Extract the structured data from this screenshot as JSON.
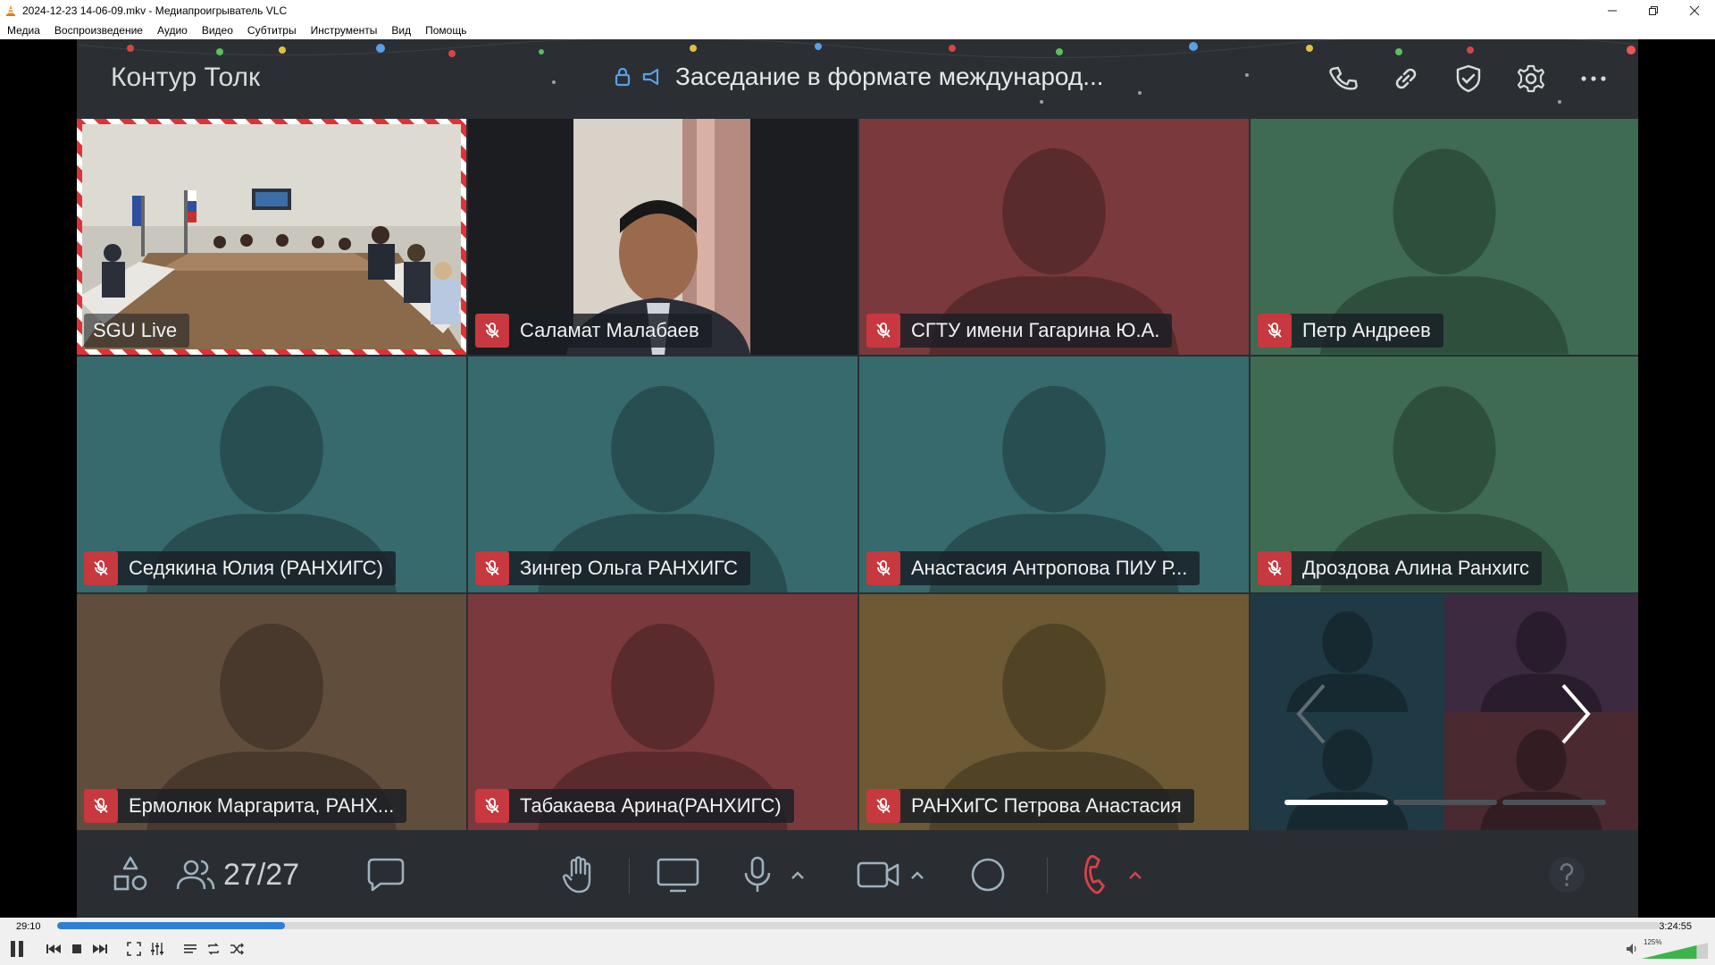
{
  "window": {
    "title": "2024-12-23 14-06-09.mkv - Медиапроигрыватель VLC"
  },
  "menu": [
    "Медиа",
    "Воспроизведение",
    "Аудио",
    "Видео",
    "Субтитры",
    "Инструменты",
    "Вид",
    "Помощь"
  ],
  "meeting": {
    "brand": "Контур Толк",
    "title": "Заседание в формате международ...",
    "header_icons": [
      "phone-icon",
      "link-icon",
      "shield-check-icon",
      "gear-icon",
      "more-icon"
    ]
  },
  "tiles": [
    {
      "name": "SGU Live",
      "type": "video-room",
      "muted": false,
      "highlight": true
    },
    {
      "name": "Саламат Малабаев",
      "type": "video-person",
      "muted": true,
      "color": "#1b1d20"
    },
    {
      "name": "СГТУ имени Гагарина Ю.А.",
      "type": "avatar",
      "muted": true,
      "color": "#7a3a3d"
    },
    {
      "name": "Петр Андреев",
      "type": "avatar",
      "muted": true,
      "color": "#3f6b52"
    },
    {
      "name": "Седякина Юлия (РАНХИГС)",
      "type": "avatar",
      "muted": true,
      "color": "#366a6d"
    },
    {
      "name": "Зингер Ольга РАНХИГС",
      "type": "avatar",
      "muted": true,
      "color": "#366a6d"
    },
    {
      "name": "Анастасия Антропова ПИУ Р...",
      "type": "avatar",
      "muted": true,
      "color": "#366a6d"
    },
    {
      "name": "Дроздова Алина Ранхигс",
      "type": "avatar",
      "muted": true,
      "color": "#3f6b52"
    },
    {
      "name": "Ермолюк Маргарита, РАНХ...",
      "type": "avatar",
      "muted": true,
      "color": "#614d3c"
    },
    {
      "name": "Табакаева Арина(РАНХИГС)",
      "type": "avatar",
      "muted": true,
      "color": "#7a3a3d"
    },
    {
      "name": "РАНХиГС Петрова Анастасия",
      "type": "avatar",
      "muted": true,
      "color": "#6d5a34"
    }
  ],
  "overflow_tile": {
    "colors": [
      "#1f3a44",
      "#3b2a40",
      "#1f3a44",
      "#4a2a30"
    ],
    "pages": 3,
    "current_page": 1
  },
  "footer": {
    "participants": "27/27",
    "icons": [
      "shapes-icon",
      "participants-icon",
      "chat-icon",
      "raise-hand-icon",
      "screen-share-icon",
      "microphone-icon",
      "camera-icon",
      "record-icon",
      "hangup-icon",
      "help-icon"
    ]
  },
  "player": {
    "elapsed": "29:10",
    "total": "3:24:55",
    "progress": 0.142,
    "volume_label": "125%",
    "volume": 0.83
  },
  "colors": {
    "accent_red": "#c8383f",
    "seek_blue": "#2f7fd6",
    "hangup": "#d9414b"
  }
}
